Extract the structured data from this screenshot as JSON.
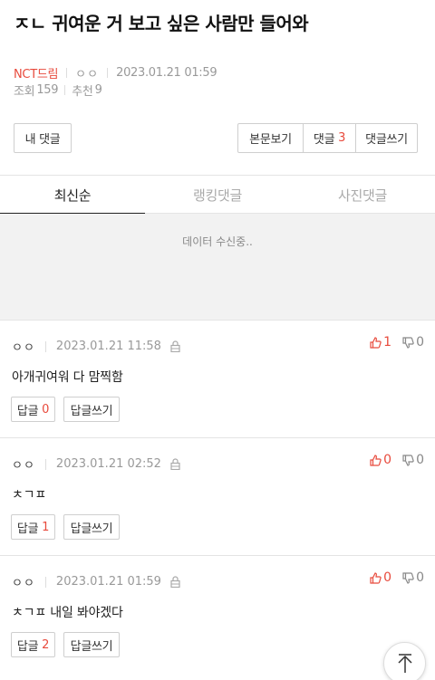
{
  "post": {
    "title": "ㅈㄴ 귀여운 거 보고 싶은 사람만 들어와",
    "board": "NCT드림",
    "author": "ㅇㅇ",
    "date": "2023.01.21 01:59",
    "views_label": "조회",
    "views": "159",
    "recommend_label": "추천",
    "recommend": "9"
  },
  "actions": {
    "my_comments": "내 댓글",
    "view_post": "본문보기",
    "comments_label": "댓글",
    "comments_count": "3",
    "write_comment": "댓글쓰기"
  },
  "tabs": [
    {
      "label": "최신순",
      "active": true
    },
    {
      "label": "랭킹댓글",
      "active": false
    },
    {
      "label": "사진댓글",
      "active": false
    }
  ],
  "loading_text": "데이터 수신중..",
  "comments": [
    {
      "author": "ㅇㅇ",
      "date": "2023.01.21 11:58",
      "up": "1",
      "down": "0",
      "body": "아개귀여워 다 맘찍함",
      "reply_label": "답글",
      "reply_count": "0",
      "reply_write": "답글쓰기"
    },
    {
      "author": "ㅇㅇ",
      "date": "2023.01.21 02:52",
      "up": "0",
      "down": "0",
      "body": "ㅊㄱㅍ",
      "reply_label": "답글",
      "reply_count": "1",
      "reply_write": "답글쓰기"
    },
    {
      "author": "ㅇㅇ",
      "date": "2023.01.21 01:59",
      "up": "0",
      "down": "0",
      "body": "ㅊㄱㅍ 내일 봐야겠다",
      "reply_label": "답글",
      "reply_count": "2",
      "reply_write": "답글쓰기"
    }
  ],
  "colors": {
    "accent": "#e84a3c",
    "muted": "#999999",
    "loading_bg": "#f2f2f2"
  },
  "icons": {
    "lock": "lock-icon",
    "up": "thumbs-up-icon",
    "down": "thumbs-down-icon",
    "top": "arrow-up-icon"
  }
}
